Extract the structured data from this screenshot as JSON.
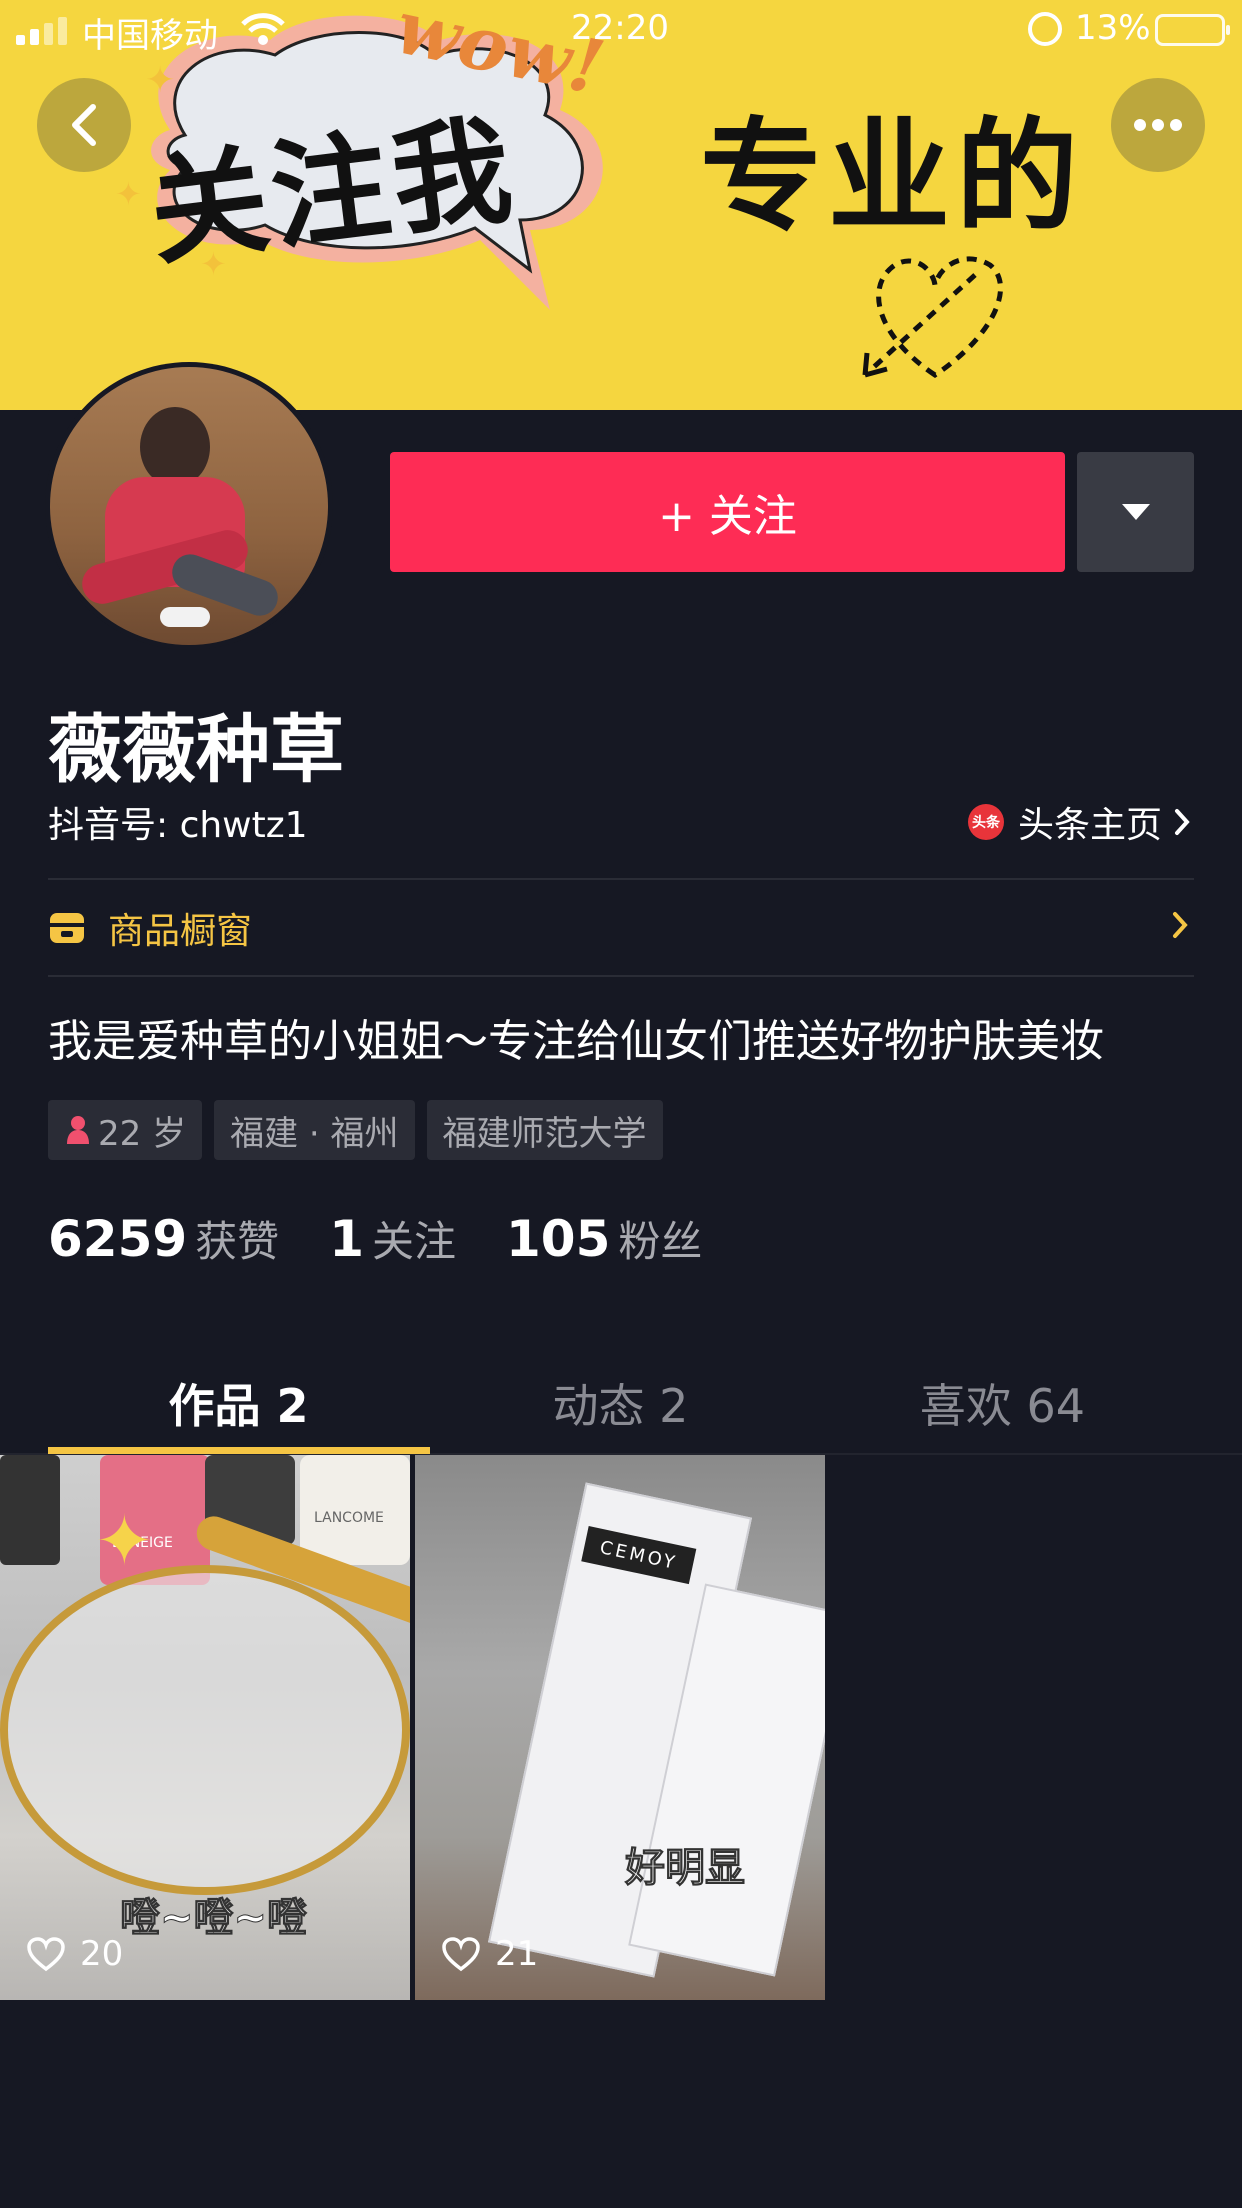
{
  "status_bar": {
    "carrier": "中国移动",
    "time": "22:20",
    "battery": "13%"
  },
  "banner": {
    "left_text": "关注我",
    "right_text": "专业的",
    "wow_text": "wow!"
  },
  "profile": {
    "follow_label": "+ 关注",
    "name": "薇薇种草",
    "douyin_id": "抖音号: chwtz1",
    "toutiao_logo": "头条",
    "toutiao_link": "头条主页",
    "shop_label": "商品橱窗",
    "bio": "我是爱种草的小姐姐～专注给仙女们推送好物护肤美妆",
    "tags": [
      "22 岁",
      "福建 · 福州",
      "福建师范大学"
    ],
    "stats": [
      {
        "num": "6259",
        "label": "获赞"
      },
      {
        "num": "1",
        "label": "关注"
      },
      {
        "num": "105",
        "label": "粉丝"
      }
    ]
  },
  "tabs": [
    "作品 2",
    "动态 2",
    "喜欢 64"
  ],
  "videos": [
    {
      "likes": "20",
      "caption": "噔~噔~噔",
      "brands": [
        "LANEIGE",
        "LANCOME"
      ]
    },
    {
      "likes": "21",
      "caption": "好明显",
      "brands": [
        "CEMOY"
      ]
    }
  ],
  "colors": {
    "background": "#161823",
    "banner": "#f5d63f",
    "follow": "#fe2c55",
    "accent": "#f5c544"
  }
}
